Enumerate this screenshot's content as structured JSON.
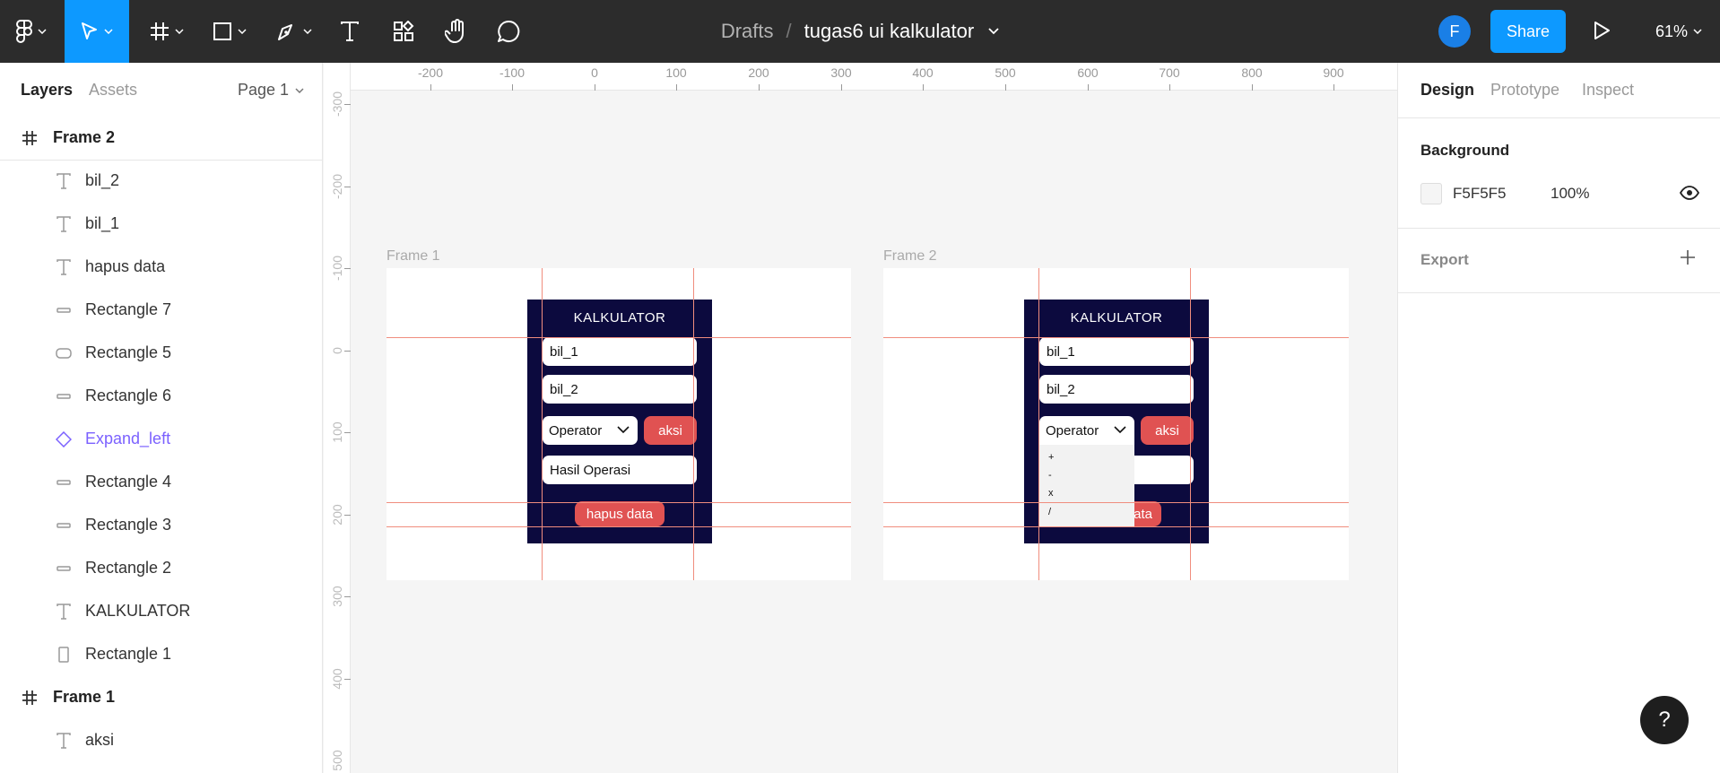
{
  "toolbar": {
    "file_location": "Drafts",
    "separator": "/",
    "file_name": "tugas6 ui kalkulator",
    "avatar_initial": "F",
    "share_label": "Share",
    "zoom": "61%"
  },
  "left_panel": {
    "tabs": [
      "Layers",
      "Assets"
    ],
    "page": "Page 1",
    "layers": [
      {
        "name": "Frame 2",
        "type": "frame"
      },
      {
        "name": "bil_2",
        "type": "text"
      },
      {
        "name": "bil_1",
        "type": "text"
      },
      {
        "name": "hapus data",
        "type": "text"
      },
      {
        "name": "Rectangle 7",
        "type": "rect"
      },
      {
        "name": "Rectangle 5",
        "type": "rect-round"
      },
      {
        "name": "Rectangle 6",
        "type": "rect"
      },
      {
        "name": "Expand_left",
        "type": "component"
      },
      {
        "name": "Rectangle 4",
        "type": "rect"
      },
      {
        "name": "Rectangle 3",
        "type": "rect"
      },
      {
        "name": "Rectangle 2",
        "type": "rect"
      },
      {
        "name": "KALKULATOR",
        "type": "text"
      },
      {
        "name": "Rectangle 1",
        "type": "rect-tall"
      },
      {
        "name": "Frame 1",
        "type": "frame"
      },
      {
        "name": "aksi",
        "type": "text"
      }
    ]
  },
  "canvas": {
    "ruler_top": [
      "-200",
      "-100",
      "0",
      "100",
      "200",
      "300",
      "400",
      "500",
      "600",
      "700",
      "800",
      "900",
      "100"
    ],
    "ruler_left": [
      "-300",
      "-200",
      "-100",
      "0",
      "100",
      "200",
      "300",
      "400",
      "500"
    ],
    "frame1": {
      "label": "Frame 1",
      "title": "KALKULATOR",
      "field1": "bil_1",
      "field2": "bil_2",
      "operator": "Operator",
      "action": "aksi",
      "result": "Hasil Operasi",
      "clear": "hapus data"
    },
    "frame2": {
      "label": "Frame 2",
      "title": "KALKULATOR",
      "field1": "bil_1",
      "field2": "bil_2",
      "operator": "Operator",
      "action": "aksi",
      "clear_partial": "ata",
      "dropdown_options": [
        "+",
        "-",
        "x",
        "/"
      ]
    }
  },
  "right_panel": {
    "tabs": [
      "Design",
      "Prototype",
      "Inspect"
    ],
    "background_heading": "Background",
    "background_hex": "F5F5F5",
    "background_opacity": "100%",
    "export_heading": "Export"
  },
  "help_label": "?",
  "colors": {
    "toolbar_bg": "#2c2c2c",
    "accent": "#0d99ff",
    "calc_bg": "#0c0a3e",
    "button_red": "#e05252",
    "guide": "#f08d7e",
    "component": "#7b61ff"
  }
}
